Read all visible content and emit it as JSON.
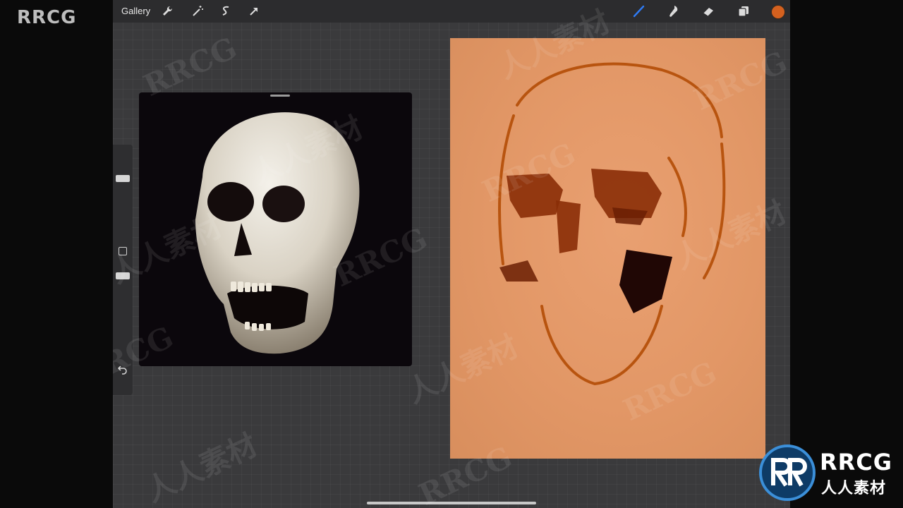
{
  "corner_mark": "RRCG",
  "toolbar": {
    "gallery_label": "Gallery",
    "left_tools": [
      "wrench-icon",
      "magic-wand-icon",
      "selection-icon",
      "transform-arrow-icon"
    ],
    "right_tools": [
      "brush-icon",
      "smudge-icon",
      "eraser-icon",
      "layers-icon"
    ],
    "active_tool": "brush-icon",
    "brush_color": "#d4611f",
    "accent_color": "#2f7bf5"
  },
  "sidebar": {
    "sliders": [
      "brush-size",
      "opacity"
    ],
    "buttons": [
      "modify-button",
      "undo-button"
    ]
  },
  "reference_window": {
    "subject": "skull photo"
  },
  "canvas": {
    "background_color": "#e29766"
  },
  "watermarks": {
    "latin": "RRCG",
    "cjk": "人人素材"
  },
  "logo": {
    "main": "RRCG",
    "sub": "人人素材"
  }
}
